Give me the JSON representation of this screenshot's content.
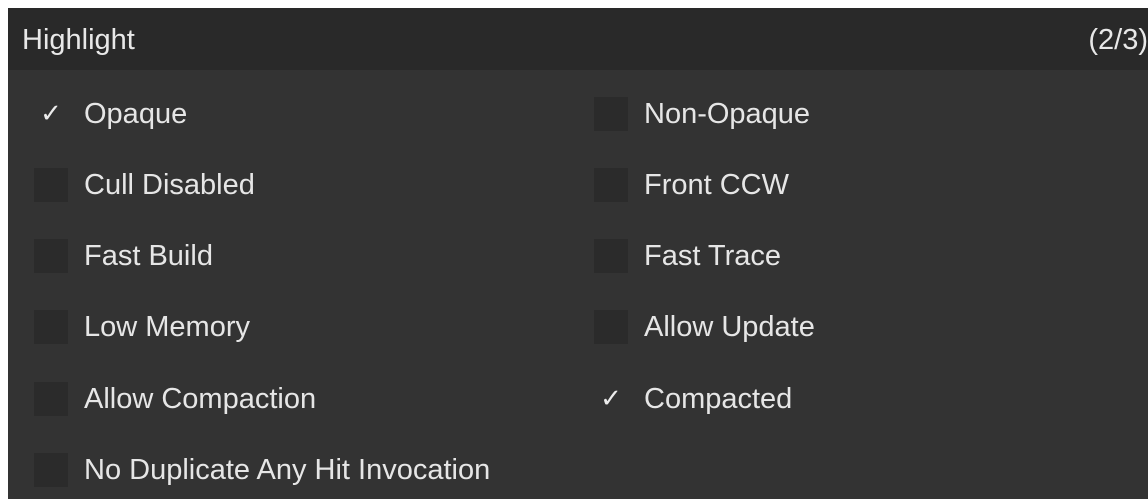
{
  "panel": {
    "title": "Highlight",
    "count": "(2/3)"
  },
  "options": [
    {
      "label": "Opaque",
      "checked": true,
      "mark": "✓"
    },
    {
      "label": "Non-Opaque",
      "checked": false,
      "mark": ""
    },
    {
      "label": "Cull Disabled",
      "checked": false,
      "mark": ""
    },
    {
      "label": "Front CCW",
      "checked": false,
      "mark": ""
    },
    {
      "label": "Fast Build",
      "checked": false,
      "mark": ""
    },
    {
      "label": "Fast Trace",
      "checked": false,
      "mark": ""
    },
    {
      "label": "Low Memory",
      "checked": false,
      "mark": ""
    },
    {
      "label": "Allow Update",
      "checked": false,
      "mark": ""
    },
    {
      "label": "Allow Compaction",
      "checked": false,
      "mark": ""
    },
    {
      "label": "Compacted",
      "checked": true,
      "mark": "✓"
    },
    {
      "label": "No Duplicate Any Hit Invocation",
      "checked": false,
      "mark": ""
    }
  ],
  "colors": {
    "panel_bg": "#333333",
    "header_bg": "#292929",
    "checkbox_bg": "#2b2b2b",
    "text": "#e6e6e6"
  }
}
